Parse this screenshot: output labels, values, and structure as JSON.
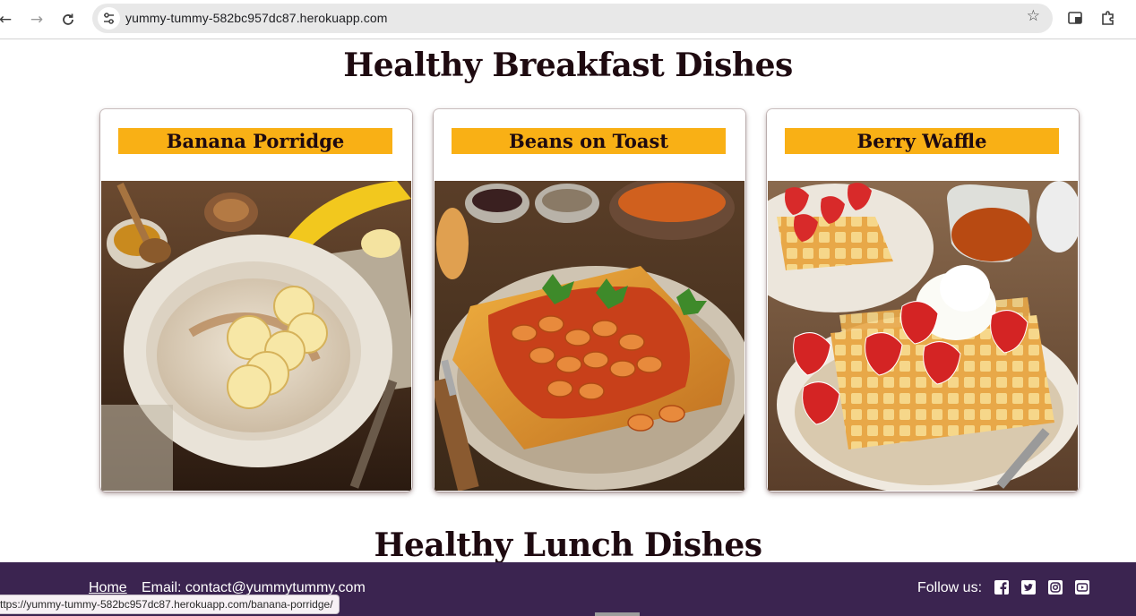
{
  "browser": {
    "url": "yummy-tummy-582bc957dc87.herokuapp.com",
    "status_url": "ttps://yummy-tummy-582bc957dc87.herokuapp.com/banana-porridge/"
  },
  "sections": {
    "breakfast_title": "Healthy Breakfast Dishes",
    "lunch_title": "Healthy Lunch Dishes"
  },
  "cards": [
    {
      "title": "Banana Porridge",
      "image": "banana-porridge-photo"
    },
    {
      "title": "Beans on Toast",
      "image": "beans-on-toast-photo"
    },
    {
      "title": "Berry Waffle",
      "image": "berry-waffle-photo"
    }
  ],
  "footer": {
    "home": "Home",
    "email": "Email: contact@yummytummy.com",
    "follow": "Follow us:",
    "social": [
      "facebook-icon",
      "twitter-icon",
      "instagram-icon",
      "youtube-icon"
    ]
  },
  "colors": {
    "title_bar": "#f9b015",
    "heading": "#1e0a10",
    "footer_bg": "#3b2450"
  }
}
